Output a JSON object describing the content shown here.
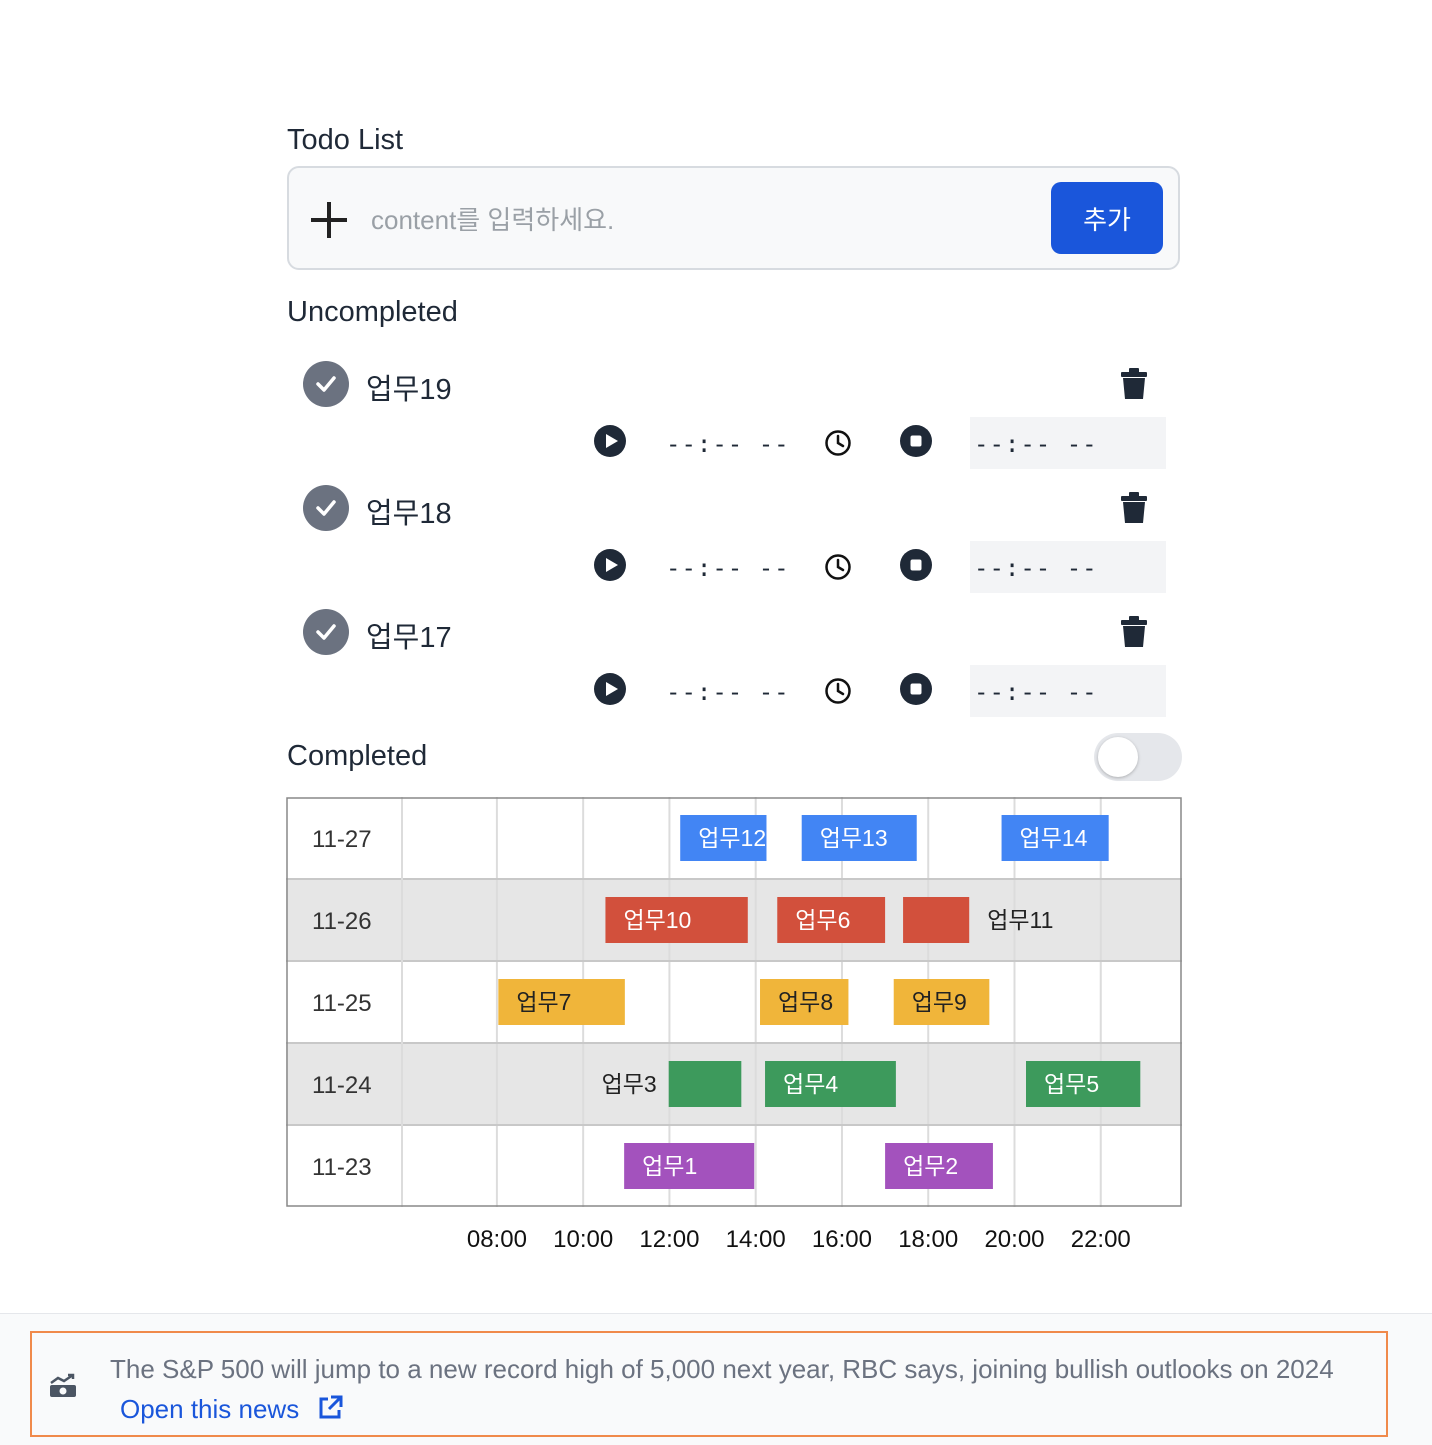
{
  "todo": {
    "title": "Todo List",
    "input_placeholder": "content를 입력하세요.",
    "add_label": "추가"
  },
  "uncompleted": {
    "title": "Uncompleted",
    "tasks": [
      {
        "name": "업무19",
        "start_time": "--:-- --",
        "end_time": "--:-- --"
      },
      {
        "name": "업무18",
        "start_time": "--:-- --",
        "end_time": "--:-- --"
      },
      {
        "name": "업무17",
        "start_time": "--:-- --",
        "end_time": "--:-- --"
      }
    ]
  },
  "completed": {
    "title": "Completed",
    "toggle_on": false
  },
  "chart_data": {
    "type": "gantt",
    "x_ticks": [
      "08:00",
      "10:00",
      "12:00",
      "14:00",
      "16:00",
      "18:00",
      "20:00",
      "22:00"
    ],
    "x_range": [
      "05:48",
      "23:53"
    ],
    "rows": [
      {
        "date": "11-27",
        "tasks": [
          {
            "name": "업무12",
            "start": "12:15",
            "end": "14:15",
            "color": "#4285f4"
          },
          {
            "name": "업무13",
            "start": "15:04",
            "end": "17:44",
            "color": "#4285f4"
          },
          {
            "name": "업무14",
            "start": "19:42",
            "end": "22:11",
            "color": "#4285f4"
          }
        ]
      },
      {
        "date": "11-26",
        "tasks": [
          {
            "name": "업무10",
            "start": "10:31",
            "end": "13:49",
            "color": "#d2503c"
          },
          {
            "name": "업무6",
            "start": "14:30",
            "end": "17:00",
            "color": "#d2503c"
          },
          {
            "name": "업무11",
            "start": "17:25",
            "end": "18:57",
            "color": "#d2503c",
            "label_outside": true
          }
        ]
      },
      {
        "date": "11-25",
        "tasks": [
          {
            "name": "업무7",
            "start": "08:02",
            "end": "10:58",
            "color": "#f0b53a"
          },
          {
            "name": "업무8",
            "start": "14:06",
            "end": "16:09",
            "color": "#f0b53a"
          },
          {
            "name": "업무9",
            "start": "17:12",
            "end": "19:25",
            "color": "#f0b53a"
          }
        ]
      },
      {
        "date": "11-24",
        "tasks": [
          {
            "name": "업무3",
            "start": "11:59",
            "end": "13:40",
            "color": "#3d9a5c",
            "label_outside": true
          },
          {
            "name": "업무4",
            "start": "14:13",
            "end": "17:15",
            "color": "#3d9a5c"
          },
          {
            "name": "업무5",
            "start": "20:16",
            "end": "22:55",
            "color": "#3d9a5c"
          }
        ]
      },
      {
        "date": "11-23",
        "tasks": [
          {
            "name": "업무1",
            "start": "10:57",
            "end": "13:58",
            "color": "#a352bd"
          },
          {
            "name": "업무2",
            "start": "17:00",
            "end": "19:30",
            "color": "#a352bd"
          }
        ]
      }
    ]
  },
  "news": {
    "text": "The S&P 500 will jump to a new record high of 5,000 next year, RBC says, joining bullish outlooks on 2024",
    "link_label": "Open this news"
  }
}
